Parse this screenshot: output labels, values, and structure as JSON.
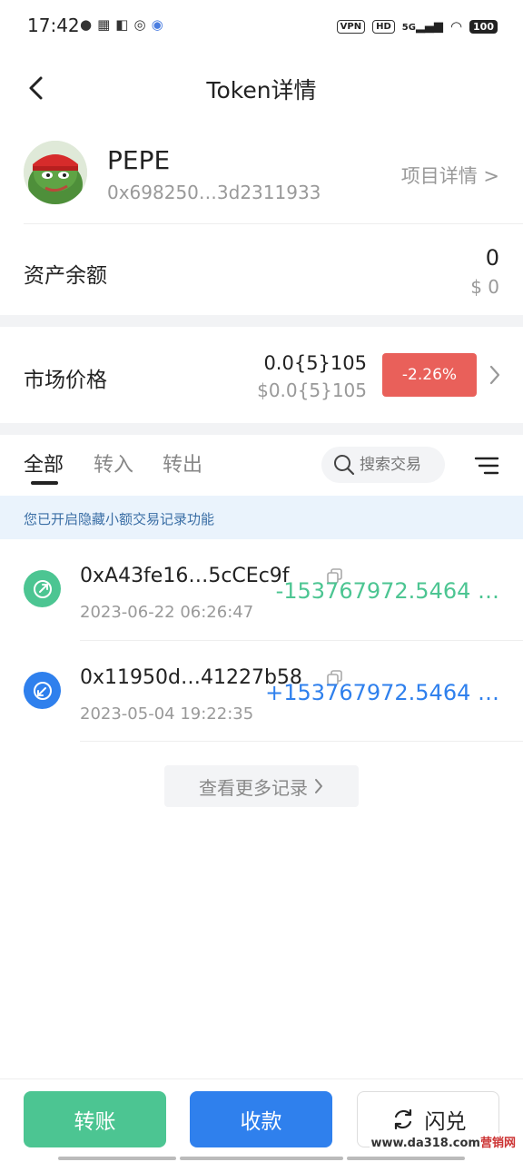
{
  "status_bar": {
    "time": "17:42",
    "vpn": "VPN",
    "hd": "HD",
    "signal": "5G",
    "battery": "100"
  },
  "header": {
    "title": "Token详情"
  },
  "token": {
    "name": "PEPE",
    "address": "0x698250…3d2311933",
    "project_link": "项目详情 >"
  },
  "balance": {
    "label": "资产余额",
    "amount": "0",
    "usd": "$ 0"
  },
  "market": {
    "label": "市场价格",
    "price": "0.0{5}105",
    "price_usd": "$0.0{5}105",
    "change": "-2.26%",
    "change_color": "#e9605a"
  },
  "tabs": [
    {
      "label": "全部"
    },
    {
      "label": "转入"
    },
    {
      "label": "转出"
    }
  ],
  "search": {
    "placeholder": "搜索交易"
  },
  "notice": "您已开启隐藏小额交易记录功能",
  "transactions": [
    {
      "address": "0xA43fe16…5cCEc9f",
      "time": "2023-06-22 06:26:47",
      "amount": "-153767972.5464 …",
      "color": "#4cc592",
      "icon": "send-icon"
    },
    {
      "address": "0x11950d…41227b58",
      "time": "2023-05-04 19:22:35",
      "amount": "+153767972.5464 …",
      "color": "#2f80ed",
      "icon": "receive-icon"
    }
  ],
  "more_records": "查看更多记录",
  "actions": {
    "send": "转账",
    "receive": "收款",
    "swap": "闪兑"
  },
  "watermark": "www.da318.com",
  "watermark_suffix": "营销网",
  "colors": {
    "green": "#4cc592",
    "blue": "#2f80ed",
    "red": "#e9605a"
  }
}
